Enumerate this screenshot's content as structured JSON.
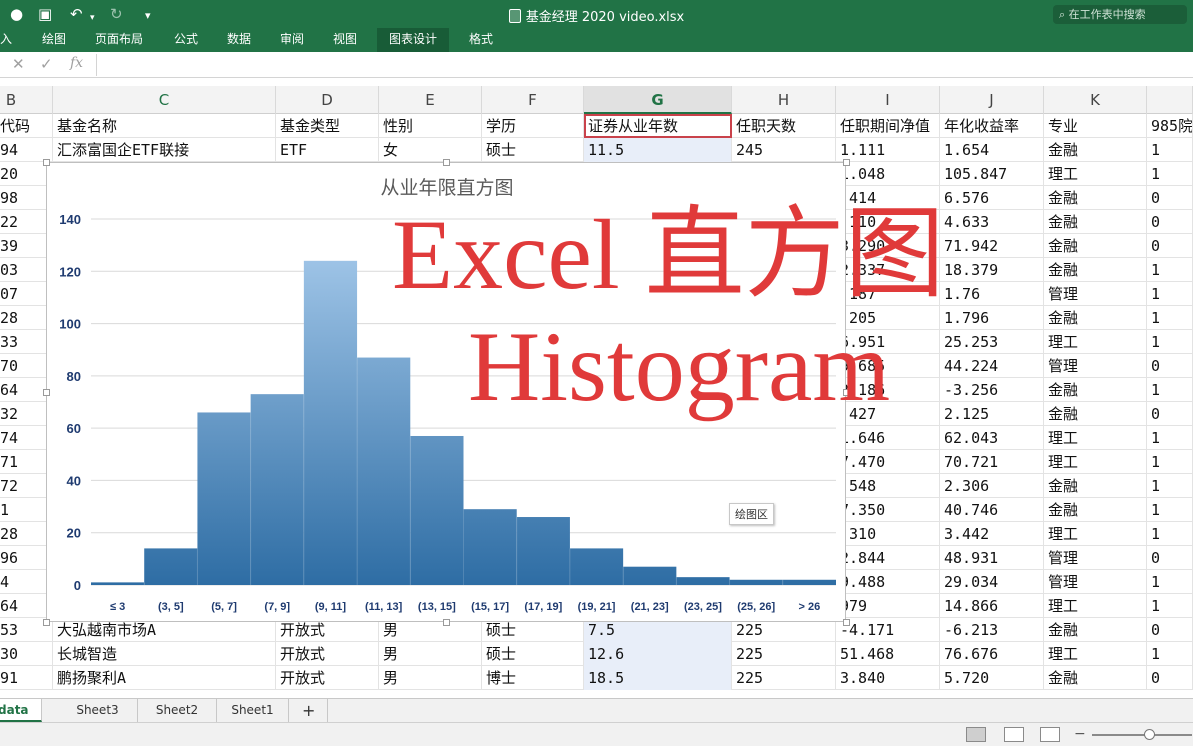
{
  "window": {
    "title": "基金经理 2020 video.xlsx",
    "search_placeholder": "在工作表中搜索"
  },
  "ribbon_tabs": [
    {
      "label": "入",
      "active": false
    },
    {
      "label": "绘图",
      "active": false
    },
    {
      "label": "页面布局",
      "active": false
    },
    {
      "label": "公式",
      "active": false
    },
    {
      "label": "数据",
      "active": false
    },
    {
      "label": "审阅",
      "active": false
    },
    {
      "label": "视图",
      "active": false
    },
    {
      "label": "图表设计",
      "active": true
    },
    {
      "label": "格式",
      "active": false
    }
  ],
  "formula_bar": {
    "cancel": "✕",
    "confirm": "✓",
    "fx": "fx"
  },
  "columns": [
    {
      "letter": "B",
      "selected": false
    },
    {
      "letter": "C",
      "selected": false
    },
    {
      "letter": "D",
      "selected": false
    },
    {
      "letter": "E",
      "selected": false
    },
    {
      "letter": "F",
      "selected": false
    },
    {
      "letter": "G",
      "selected": true
    },
    {
      "letter": "H",
      "selected": false
    },
    {
      "letter": "I",
      "selected": false
    },
    {
      "letter": "J",
      "selected": false
    },
    {
      "letter": "K",
      "selected": false
    },
    {
      "letter": "",
      "selected": false
    }
  ],
  "header_row": [
    "代码",
    "基金名称",
    "基金类型",
    "性别",
    "学历",
    "证券从业年数",
    "任职天数",
    "任职期间净值",
    "年化收益率",
    "专业",
    "985院"
  ],
  "rows": [
    [
      "94",
      "汇添富国企ETF联接",
      "ETF",
      "女",
      "硕士",
      "11.5",
      "245",
      "1.111",
      "1.654",
      "金融",
      "1"
    ],
    [
      "20",
      "",
      "",
      "",
      "",
      "",
      "",
      "1.048",
      "105.847",
      "理工",
      "1"
    ],
    [
      "98",
      "",
      "",
      "",
      "",
      "",
      "",
      ".414",
      "6.576",
      "金融",
      "0"
    ],
    [
      "22",
      "",
      "",
      "",
      "",
      "",
      "",
      ".110",
      "4.633",
      "金融",
      "0"
    ],
    [
      "39",
      "",
      "",
      "",
      "",
      "",
      "",
      "3.290",
      "71.942",
      "金融",
      "0"
    ],
    [
      "03",
      "",
      "",
      "",
      "",
      "",
      "",
      "2.337",
      "18.379",
      "金融",
      "1"
    ],
    [
      "07",
      "",
      "",
      "",
      "",
      "",
      "",
      ".187",
      "1.76",
      "管理",
      "1"
    ],
    [
      "28",
      "",
      "",
      "",
      "",
      "",
      "",
      ".205",
      "1.796",
      "金融",
      "1"
    ],
    [
      "33",
      "",
      "",
      "",
      "",
      "",
      "",
      "6.951",
      "25.253",
      "理工",
      "1"
    ],
    [
      "70",
      "",
      "",
      "",
      "",
      "",
      "",
      "9.685",
      "44.224",
      "管理",
      "0"
    ],
    [
      "64",
      "",
      "",
      "",
      "",
      "",
      "",
      "2.186",
      "-3.256",
      "金融",
      "1"
    ],
    [
      "32",
      "",
      "",
      "",
      "",
      "",
      "",
      ".427",
      "2.125",
      "金融",
      "0"
    ],
    [
      "74",
      "",
      "",
      "",
      "",
      "",
      "",
      "1.646",
      "62.043",
      "理工",
      "1"
    ],
    [
      "71",
      "",
      "",
      "",
      "",
      "",
      "",
      "7.470",
      "70.721",
      "理工",
      "1"
    ],
    [
      "72",
      "",
      "",
      "",
      "",
      "",
      "",
      ".548",
      "2.306",
      "金融",
      "1"
    ],
    [
      "1",
      "",
      "",
      "",
      "",
      "",
      "",
      "7.350",
      "40.746",
      "金融",
      "1"
    ],
    [
      "28",
      "",
      "",
      "",
      "",
      "",
      "",
      ".310",
      "3.442",
      "理工",
      "1"
    ],
    [
      "96",
      "",
      "",
      "",
      "",
      "",
      "",
      "2.844",
      "48.931",
      "管理",
      "0"
    ],
    [
      "4",
      "",
      "",
      "",
      "",
      "",
      "",
      "9.488",
      "29.034",
      "管理",
      "1"
    ],
    [
      "64",
      "",
      "",
      "",
      "",
      "",
      "",
      "979",
      "14.866",
      "理工",
      "1"
    ],
    [
      "53",
      "大弘越南市场A",
      "开放式",
      "男",
      "硕士",
      "7.5",
      "225",
      "-4.171",
      "-6.213",
      "金融",
      "0"
    ],
    [
      "30",
      "长城智造",
      "开放式",
      "男",
      "硕士",
      "12.6",
      "225",
      "51.468",
      "76.676",
      "理工",
      "1"
    ],
    [
      "91",
      "鹏扬聚利A",
      "开放式",
      "男",
      "博士",
      "18.5",
      "225",
      "3.840",
      "5.720",
      "金融",
      "0"
    ]
  ],
  "chart_data": {
    "type": "bar",
    "title": "从业年限直方图",
    "categories": [
      "≤ 3",
      "(3, 5]",
      "(5, 7]",
      "(7, 9]",
      "(9, 11]",
      "(11, 13]",
      "(13, 15]",
      "(15, 17]",
      "(17, 19]",
      "(19, 21]",
      "(21, 23]",
      "(23, 25]",
      "(25, 26]",
      "> 26"
    ],
    "values": [
      1,
      14,
      66,
      73,
      124,
      87,
      57,
      29,
      26,
      14,
      7,
      3,
      2,
      2
    ],
    "ylim": [
      0,
      140
    ],
    "yticks": [
      0,
      20,
      40,
      60,
      80,
      100,
      120,
      140
    ],
    "grid": true,
    "legend": "none",
    "bar_gap": 0,
    "colors": {
      "top": "#9dc3e6",
      "bottom": "#2e6da4",
      "axis_labels": "#1f3b70",
      "title": "#5a5a5a",
      "gridline": "#d9d9d9"
    }
  },
  "plot_area_tooltip": "绘图区",
  "overlay": {
    "line1": "Excel 直方图",
    "line2": "Histogram",
    "color": "#e03a3a"
  },
  "sheet_tabs": [
    {
      "label": "data",
      "active": true
    },
    {
      "label": "Sheet3",
      "active": false
    },
    {
      "label": "Sheet2",
      "active": false
    },
    {
      "label": "Sheet1",
      "active": false
    }
  ],
  "add_sheet_label": "+",
  "theme": {
    "excel_green": "#217346",
    "selected_col": "#e8eef9",
    "highlight_border": "#c9424b"
  }
}
